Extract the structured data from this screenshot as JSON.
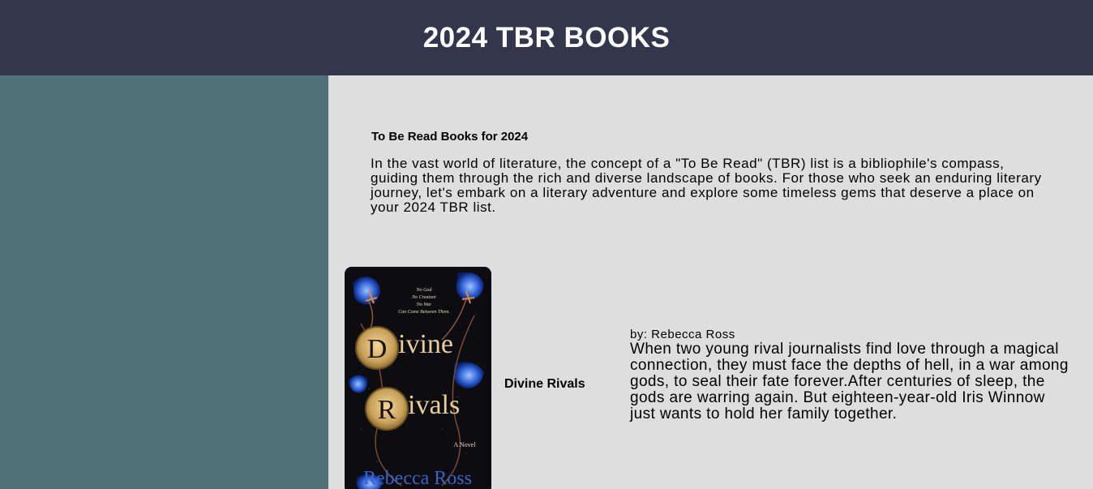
{
  "header": {
    "title": "2024 TBR BOOKS"
  },
  "intro": {
    "title": "To Be Read Books for 2024",
    "text": "In the vast world of literature, the concept of a \"To Be Read\" (TBR) list is a bibliophile's compass, guiding them through the rich and diverse landscape of books. For those who seek an enduring literary journey, let's embark on a literary adventure and explore some timeless gems that deserve a place on your 2024 TBR list."
  },
  "books": [
    {
      "title": "Divine Rivals",
      "author": "by: Rebecca Ross",
      "description": "When two young rival journalists find love through a magical connection, they must face the depths of hell, in a war among gods, to seal their fate forever.After centuries of sleep, the gods are warring again. But eighteen-year-old Iris Winnow just wants to hold her family together.",
      "cover": {
        "tagline_1": "No God",
        "tagline_2": "No Creature",
        "tagline_3": "No War",
        "tagline_4": "Can Come Between Them.",
        "word_1": "ivine",
        "word_1_initial": "D",
        "word_2": "ivals",
        "word_2_initial": "R",
        "subtitle": "A Novel",
        "author": "Rebecca Ross"
      }
    }
  ],
  "colors": {
    "header_bg": "#34374b",
    "sidebar_bg": "#4e7178",
    "main_bg": "#dedede"
  }
}
